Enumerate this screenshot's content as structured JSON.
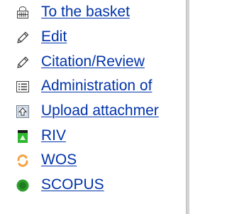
{
  "menu": {
    "items": [
      {
        "label": "To the basket",
        "icon": "basket-icon"
      },
      {
        "label": "Edit",
        "icon": "pencil-icon"
      },
      {
        "label": "Citation/Review",
        "icon": "pencil-icon"
      },
      {
        "label": "Administration of",
        "icon": "list-document-icon"
      },
      {
        "label": "Upload attachmer",
        "icon": "upload-icon"
      },
      {
        "label": "RIV",
        "icon": "riv-icon"
      },
      {
        "label": "WOS",
        "icon": "wos-icon"
      },
      {
        "label": "SCOPUS",
        "icon": "scopus-icon"
      }
    ]
  },
  "colors": {
    "link": "#0033aa",
    "riv_green": "#2db82d",
    "wos_orange": "#f5a03c",
    "scopus_green": "#2e9e2e"
  }
}
